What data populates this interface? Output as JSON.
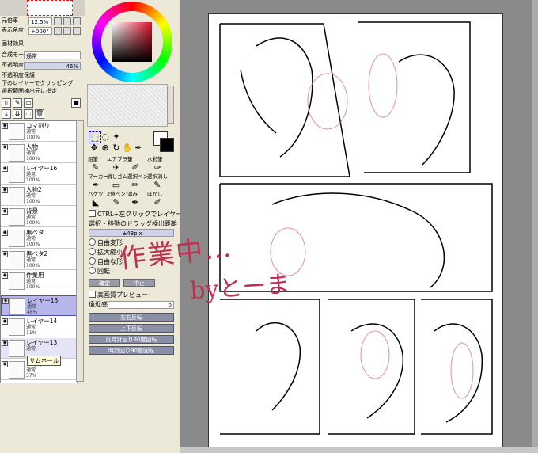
{
  "navigator": {
    "zoom_label": "元倍率",
    "zoom_value": "12.5%",
    "angle_label": "表示角度",
    "angle_value": "+000°"
  },
  "paper_effect": {
    "title": "画材効果"
  },
  "layer_props": {
    "blend_label": "合成モード",
    "blend_value": "通常",
    "opacity_label": "不透明度",
    "opacity_value": "46%",
    "protect": "不透明度保護",
    "clip": "下のレイヤーでクリッピング",
    "selection_source": "選択範囲抽出元に指定"
  },
  "layers": [
    {
      "name": "コマ割り",
      "mode": "通常",
      "opacity": "100%",
      "selected": false
    },
    {
      "name": "人物",
      "mode": "通常",
      "opacity": "100%",
      "selected": false
    },
    {
      "name": "レイヤー16",
      "mode": "通常",
      "opacity": "100%",
      "selected": false
    },
    {
      "name": "人物2",
      "mode": "通常",
      "opacity": "100%",
      "selected": false
    },
    {
      "name": "背景",
      "mode": "通常",
      "opacity": "100%",
      "selected": false
    },
    {
      "name": "黒ベタ",
      "mode": "通常",
      "opacity": "100%",
      "selected": false
    },
    {
      "name": "黒ベタ2",
      "mode": "通常",
      "opacity": "100%",
      "selected": false
    },
    {
      "name": "作業用",
      "mode": "通常",
      "opacity": "100%",
      "selected": false
    },
    {
      "name": "レイヤー15",
      "mode": "通常",
      "opacity": "46%",
      "selected": true
    },
    {
      "name": "レイヤー14",
      "mode": "通常",
      "opacity": "11%",
      "selected": false
    },
    {
      "name": "レイヤー13",
      "mode": "通常",
      "opacity": "",
      "selected": false
    },
    {
      "name": "レイヤー10",
      "mode": "通常",
      "opacity": "37%",
      "selected": false
    }
  ],
  "tooltip": "サムネール",
  "tools": [
    {
      "label": "鉛筆",
      "icon": "✎"
    },
    {
      "label": "エアブラシ",
      "icon": "✈"
    },
    {
      "label": "筆",
      "icon": "✐"
    },
    {
      "label": "水彩筆",
      "icon": "✑"
    },
    {
      "label": "マーカー",
      "icon": "✒"
    },
    {
      "label": "消しゴム",
      "icon": "▭"
    },
    {
      "label": "選択ペン",
      "icon": "✏"
    },
    {
      "label": "選択消し",
      "icon": "✎"
    },
    {
      "label": "バケツ",
      "icon": "◣"
    },
    {
      "label": "2値ペン",
      "icon": "✎"
    },
    {
      "label": "濃み",
      "icon": "✒"
    },
    {
      "label": "ぼかし",
      "icon": "✐"
    }
  ],
  "options": {
    "ctrl_click": "CTRL+左クリックでレイヤー選択",
    "drag_threshold": "選択・移動のドラッグ検出距離",
    "drag_value": "±48pix",
    "free_transform": "自由変形",
    "scale": "拡大縮小",
    "free_shape": "自由な形",
    "rotate": "回転",
    "confirm": "確定",
    "cancel": "中止",
    "hq_preview": "高画質プレビュー",
    "perspective_label": "遠近感",
    "perspective_value": "0",
    "flip_h": "左右反転",
    "flip_v": "上下反転",
    "rot_ccw": "反時計回り90度回転",
    "rot_cw": "時計回り90度回転"
  },
  "overlay": {
    "line1": "作業中…",
    "line2": "byとーま"
  },
  "colors": {
    "accent": "#c03050",
    "selected_layer": "#b7b7ee",
    "panel": "#ece9d8"
  }
}
